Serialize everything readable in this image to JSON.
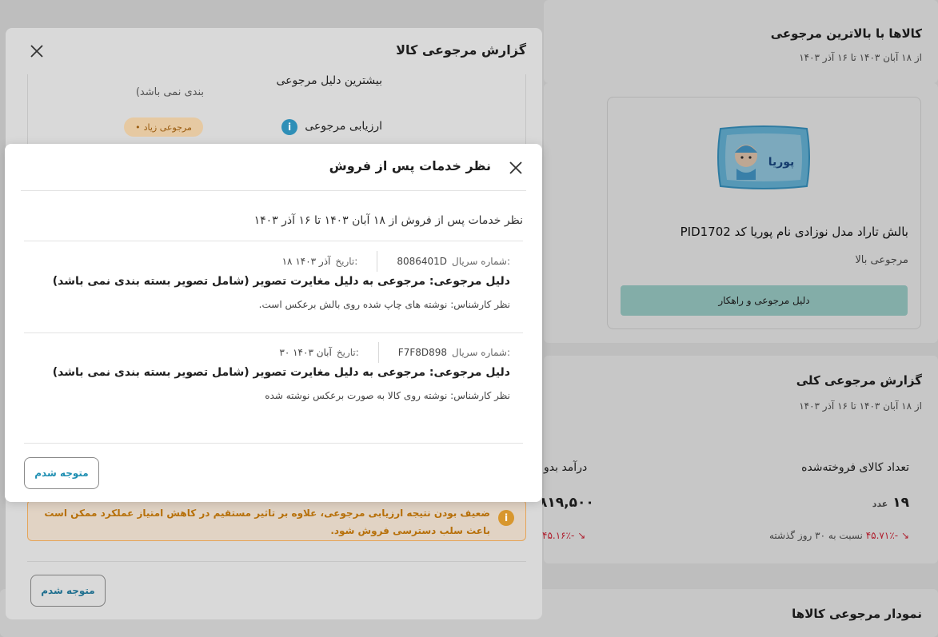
{
  "background": {
    "top_products": {
      "title": "کالاها با بالاترین مرجوعی",
      "date_range": "از ۱۸ آبان ۱۴۰۳ تا ۱۶ آذر ۱۴۰۳",
      "product_name": "بالش تاراد مدل نوزادی نام پوریا کد PID1702",
      "return_level": "مرجوعی بالا",
      "reason_button": "دلیل مرجوعی و راهکار",
      "product_image_text": "پوریا"
    },
    "overall_report": {
      "title": "گزارش مرجوعی کلی",
      "date_range": "از ۱۸ آبان ۱۴۰۳ تا ۱۶ آذر ۱۴۰۳",
      "sold_label": "تعداد کالای فروخته‌شده",
      "sold_value": "۱۹",
      "sold_unit": "عدد",
      "sold_change": "-۴۵.۷۱٪",
      "sold_change_suffix": "نسبت به ۳۰ روز گذشته",
      "income_label": "درآمد بدو",
      "income_value": "۸۱۹,۵۰۰",
      "income_change": "-۴۵.۱۶٪"
    },
    "chart_section": {
      "title": "نمودار مرجوعی کالاها"
    }
  },
  "report_modal": {
    "title": "گزارش مرجوعی کالا",
    "top_reason_label": "بیشترین دلیل مرجوعی",
    "top_reason_value": "بندی نمی باشد)",
    "assessment_label": "ارزیابی مرجوعی",
    "assessment_chip": "مرجوعی زیاد",
    "warning_text": "ضعیف بودن نتیجه ارزیابی مرجوعی، علاوه بر تاثیر مستقیم در کاهش امتیاز عملکرد ممکن است باعث سلب دسترسی فروش شود.",
    "ok_button": "متوجه شدم"
  },
  "service_modal": {
    "title": "نظر خدمات پس از فروش",
    "subtitle": "نظر خدمات پس از فروش از ۱۸ آبان ۱۴۰۳ تا ۱۶ آذر ۱۴۰۳",
    "entries": [
      {
        "serial_label": "شماره سریال:",
        "serial": "8086401D",
        "date_label": "تاریخ:",
        "date": "۱۸ آذر ۱۴۰۳",
        "reason": "دلیل مرجوعی: مرجوعی به دلیل مغایرت تصویر (شامل تصویر بسته بندی نمی باشد)",
        "note": "نظر کارشناس: نوشته های چاپ شده روی بالش برعکس است."
      },
      {
        "serial_label": "شماره سریال:",
        "serial": "F7F8D898",
        "date_label": "تاریخ:",
        "date": "۳۰ آبان ۱۴۰۳",
        "reason": "دلیل مرجوعی: مرجوعی به دلیل مغایرت تصویر (شامل تصویر بسته بندی نمی باشد)",
        "note": "نظر کارشناس: نوشته روی کالا به صورت برعکس نوشته شده"
      }
    ],
    "ok_button": "متوجه شدم"
  },
  "colors": {
    "accent": "#1f8fb2",
    "negative": "#e0283c",
    "warning": "#d8972e",
    "reason_button_bg": "#a8ded8"
  }
}
